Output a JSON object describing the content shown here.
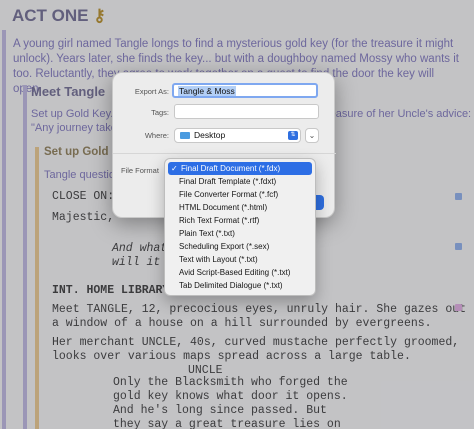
{
  "editor": {
    "act_title": "ACT ONE",
    "act_summary": "A young girl named Tangle longs to find a mysterious gold key (for the treasure it might unlock). Years later, she finds the key... but with a doughboy named Mossy who wants it too. Reluctantly, they agree to work together on a quest to find the door the key will open.",
    "sequence_title": "Meet Tangle",
    "sequence_summary": "Set up Gold Key. Tangle loves adventures and longs for the treasure of her Uncle's advice:\n\"Any journey taken ...",
    "scene_title": "Set up Gold K",
    "scene_summary": "Tangle question",
    "script_lines": [
      {
        "text": "CLOSE ON: J",
        "style": "normal"
      },
      {
        "text": "Majestic,",
        "style": "normal"
      },
      {
        "text": "And what",
        "style": "ital"
      },
      {
        "text": "will it c",
        "style": "ital"
      },
      {
        "text": "INT. HOME LIBRARY -",
        "style": "bold"
      },
      {
        "text": "Meet TANGLE, 12, precocious eyes, unruly hair. She gazes out\na window of a house on a hill surrounded by evergreens.",
        "style": "normal"
      },
      {
        "text": "Her merchant UNCLE, 40s, curved mustache perfectly groomed,\nlooks over various maps spread across a large table.",
        "style": "normal"
      },
      {
        "text": "UNCLE",
        "style": "normal"
      },
      {
        "text": "Only the Blacksmith who forged the\ngold key knows what door it opens.\nAnd he's long since passed. But\nthey say a great treasure lies on\nthe other side of the door.",
        "style": "normal"
      }
    ]
  },
  "export_sheet": {
    "export_as_label": "Export As:",
    "export_as_value": "Tangle & Moss",
    "tags_label": "Tags:",
    "tags_value": "",
    "where_label": "Where:",
    "where_value": "Desktop",
    "file_format_label": "File Format"
  },
  "format_menu": {
    "items": [
      {
        "label": "Final Draft Document (*.fdx)",
        "selected": true
      },
      {
        "label": "Final Draft Template (*.fdxt)",
        "selected": false
      },
      {
        "label": "File Converter Format (*.fcf)",
        "selected": false
      },
      {
        "label": "HTML Document (*.html)",
        "selected": false
      },
      {
        "label": "Rich Text Format (*.rtf)",
        "selected": false
      },
      {
        "label": "Plain Text (*.txt)",
        "selected": false
      },
      {
        "label": "Scheduling Export (*.sex)",
        "selected": false
      },
      {
        "label": "Text with Layout (*.txt)",
        "selected": false
      },
      {
        "label": "Avid Script-Based Editing (*.txt)",
        "selected": false
      },
      {
        "label": "Tab Delimited Dialogue (*.txt)",
        "selected": false
      }
    ],
    "check_glyph": "✓"
  },
  "colors": {
    "accent": "#2d6ee5",
    "act_color": "#7c74b6",
    "scene_bar": "#e0c089"
  }
}
